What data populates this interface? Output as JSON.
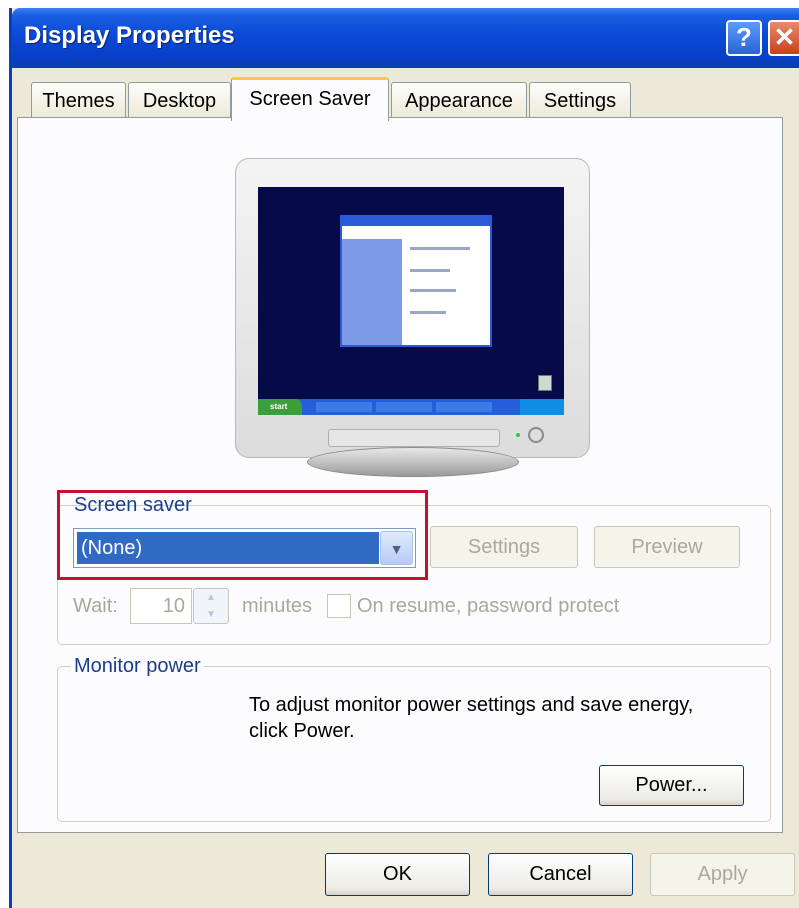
{
  "window": {
    "title": "Display Properties",
    "help_glyph": "?",
    "close_glyph": "✕"
  },
  "tabs": [
    {
      "label": "Themes",
      "active": false
    },
    {
      "label": "Desktop",
      "active": false
    },
    {
      "label": "Screen Saver",
      "active": true
    },
    {
      "label": "Appearance",
      "active": false
    },
    {
      "label": "Settings",
      "active": false
    }
  ],
  "preview": {
    "taskbar_start": "start"
  },
  "screen_saver": {
    "group_label": "Screen saver",
    "selected": "(None)",
    "settings_label": "Settings",
    "preview_label": "Preview",
    "wait_label": "Wait:",
    "wait_value": "10",
    "minutes_label": "minutes",
    "password_label": "On resume, password protect",
    "password_checked": false
  },
  "monitor_power": {
    "group_label": "Monitor power",
    "description_line1": "To adjust monitor power settings and save energy,",
    "description_line2": "click Power.",
    "power_label": "Power..."
  },
  "footer": {
    "ok_label": "OK",
    "cancel_label": "Cancel",
    "apply_label": "Apply"
  },
  "colors": {
    "title_bar": "#0b4ad8",
    "selection": "#316ac5",
    "highlight_box": "#c8102e",
    "tab_accent": "#ffc83c"
  }
}
